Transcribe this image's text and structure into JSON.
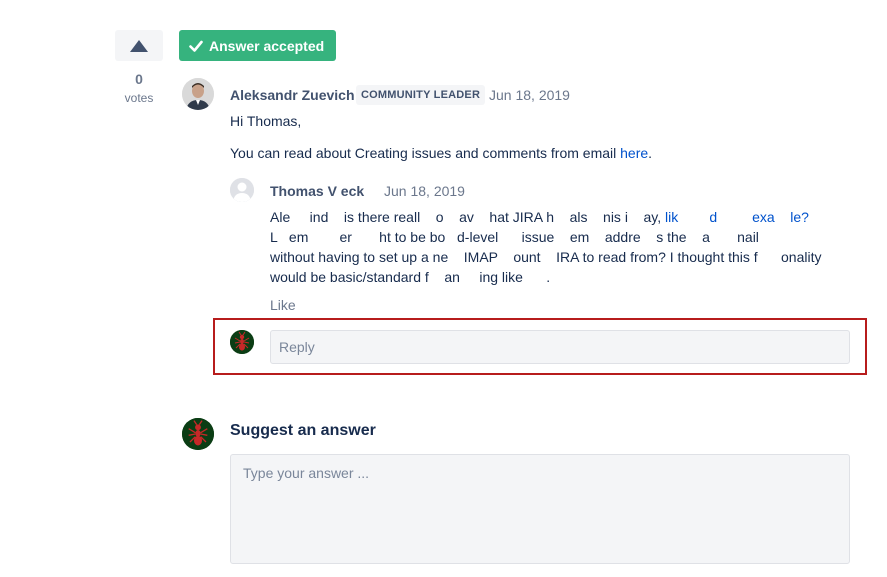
{
  "vote": {
    "count": "0",
    "label": "votes"
  },
  "accepted_badge": {
    "label": "Answer accepted",
    "color": "#36b37e"
  },
  "answer": {
    "author": "Aleksandr Zuevich",
    "badge": "COMMUNITY LEADER",
    "date": "Jun 18, 2019",
    "greeting": "Hi Thomas,",
    "text_prefix": "You can read about Creating issues and comments from email ",
    "link_text": "here",
    "text_suffix": "."
  },
  "comment": {
    "author": "Thomas V    eck",
    "date": "Jun 18, 2019",
    "line1_text": "Ale     ind    is there reall    o    av    hat JIRA h    als    nis i    ay, ",
    "line1_link": "lik        d         exa    le?",
    "line2": "L   em        er       ht to be bo   d-level      issue    em    addre    s the    a       nail",
    "line3": "without having to set up a ne    IMAP    ount    IRA to read from? I thought this f      onality",
    "line4_prefix": "would be basic/standard f    an     ing like ",
    "line4_link": "     ",
    "line4_suffix": ".",
    "like_label": "Like"
  },
  "reply": {
    "placeholder": "Reply",
    "highlight_color": "#b71c1c"
  },
  "suggest": {
    "title": "Suggest an answer",
    "placeholder": "Type your answer ..."
  }
}
